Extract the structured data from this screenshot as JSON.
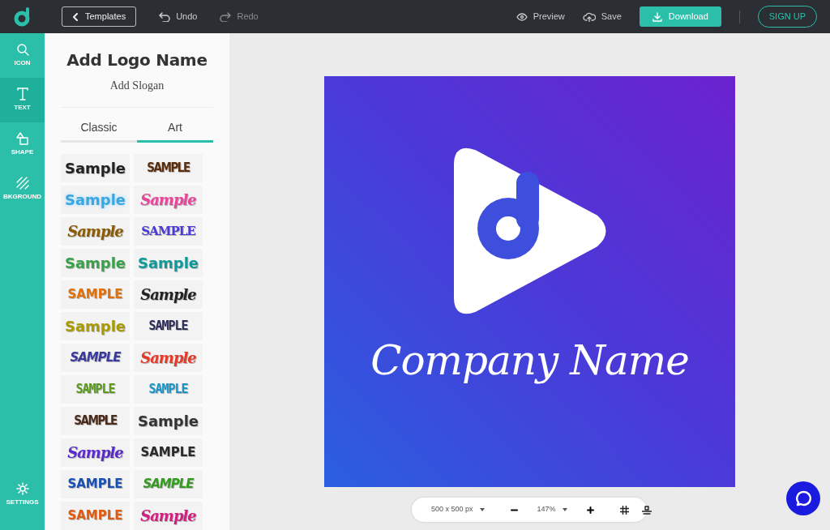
{
  "topbar": {
    "templates_button": "Templates",
    "undo": "Undo",
    "redo": {
      "label": "Redo",
      "disabled": true
    },
    "preview": "Preview",
    "save": "Save",
    "download": "Download",
    "signup": "SIGN UP"
  },
  "sidebar": {
    "items": [
      {
        "label": "ICON",
        "kind": "search",
        "selected": false
      },
      {
        "label": "TEXT",
        "kind": "text",
        "selected": true
      },
      {
        "label": "SHAPE",
        "kind": "shape",
        "selected": false
      },
      {
        "label": "BKGROUND",
        "kind": "background",
        "selected": false
      }
    ],
    "settings": "SETTINGS"
  },
  "panel": {
    "logo_name": "Add Logo Name",
    "slogan": "Add Slogan",
    "tabs": [
      {
        "label": "Classic",
        "selected": false
      },
      {
        "label": "Art",
        "selected": true
      }
    ],
    "styles": [
      {
        "text": "Sample",
        "kind": "bold",
        "color": "#222222"
      },
      {
        "text": "SAMPLE",
        "kind": "condensed",
        "color": "#5a2d0c"
      },
      {
        "text": "Sample",
        "kind": "glow",
        "color": "#3aa6e0"
      },
      {
        "text": "Sample",
        "kind": "script",
        "color": "#e8459b"
      },
      {
        "text": "Sample",
        "kind": "script",
        "color": "#8a5a05"
      },
      {
        "text": "SAMPLE",
        "kind": "serif",
        "color": "#4a3bd6"
      },
      {
        "text": "Sample",
        "kind": "bold",
        "color": "#3aa04a"
      },
      {
        "text": "Sample",
        "kind": "bold",
        "color": "#0f9a9a"
      },
      {
        "text": "SAMPLE",
        "kind": "bold",
        "color": "#e0700a"
      },
      {
        "text": "Sample",
        "kind": "script",
        "color": "#222222"
      },
      {
        "text": "Sample",
        "kind": "bold",
        "color": "#a89a00"
      },
      {
        "text": "SAMPLE",
        "kind": "blocky",
        "color": "#2d2d5a"
      },
      {
        "text": "SAMPLE",
        "kind": "italic",
        "color": "#3a3a9a"
      },
      {
        "text": "Sample",
        "kind": "script",
        "color": "#e23b2a"
      },
      {
        "text": "SAMPLE",
        "kind": "blocky",
        "color": "#5a9a1d"
      },
      {
        "text": "SAMPLE",
        "kind": "blocky",
        "color": "#1a95ca"
      },
      {
        "text": "SAMPLE",
        "kind": "condensed",
        "color": "#4a2a1a"
      },
      {
        "text": "Sample",
        "kind": "bold",
        "color": "#333333"
      },
      {
        "text": "Sample",
        "kind": "script",
        "color": "#5a2bc9"
      },
      {
        "text": "SAMPLE",
        "kind": "bold",
        "color": "#2a2a2a"
      },
      {
        "text": "SAMPLE",
        "kind": "bold",
        "color": "#1a4fb5"
      },
      {
        "text": "SAMPLE",
        "kind": "italic",
        "color": "#359a20"
      },
      {
        "text": "SAMPLE",
        "kind": "bold",
        "color": "#e05a10"
      },
      {
        "text": "Sample",
        "kind": "script",
        "color": "#d0207f"
      }
    ]
  },
  "canvas": {
    "company_name": "Company Name"
  },
  "toolbar": {
    "size": "500 x 500 px",
    "zoom": "147%"
  }
}
